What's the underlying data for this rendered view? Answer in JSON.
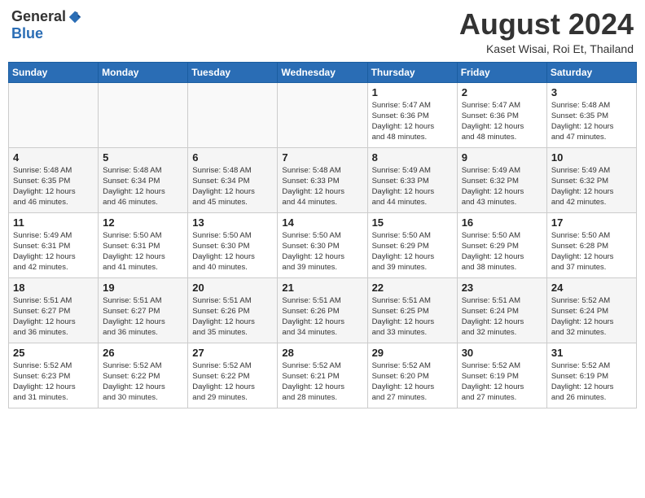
{
  "header": {
    "logo_general": "General",
    "logo_blue": "Blue",
    "month_year": "August 2024",
    "location": "Kaset Wisai, Roi Et, Thailand"
  },
  "weekdays": [
    "Sunday",
    "Monday",
    "Tuesday",
    "Wednesday",
    "Thursday",
    "Friday",
    "Saturday"
  ],
  "weeks": [
    [
      {
        "day": "",
        "empty": true
      },
      {
        "day": "",
        "empty": true
      },
      {
        "day": "",
        "empty": true
      },
      {
        "day": "",
        "empty": true
      },
      {
        "day": "1",
        "sunrise": "5:47 AM",
        "sunset": "6:36 PM",
        "daylight": "12 hours and 48 minutes."
      },
      {
        "day": "2",
        "sunrise": "5:47 AM",
        "sunset": "6:36 PM",
        "daylight": "12 hours and 48 minutes."
      },
      {
        "day": "3",
        "sunrise": "5:48 AM",
        "sunset": "6:35 PM",
        "daylight": "12 hours and 47 minutes."
      }
    ],
    [
      {
        "day": "4",
        "sunrise": "5:48 AM",
        "sunset": "6:35 PM",
        "daylight": "12 hours and 46 minutes."
      },
      {
        "day": "5",
        "sunrise": "5:48 AM",
        "sunset": "6:34 PM",
        "daylight": "12 hours and 46 minutes."
      },
      {
        "day": "6",
        "sunrise": "5:48 AM",
        "sunset": "6:34 PM",
        "daylight": "12 hours and 45 minutes."
      },
      {
        "day": "7",
        "sunrise": "5:48 AM",
        "sunset": "6:33 PM",
        "daylight": "12 hours and 44 minutes."
      },
      {
        "day": "8",
        "sunrise": "5:49 AM",
        "sunset": "6:33 PM",
        "daylight": "12 hours and 44 minutes."
      },
      {
        "day": "9",
        "sunrise": "5:49 AM",
        "sunset": "6:32 PM",
        "daylight": "12 hours and 43 minutes."
      },
      {
        "day": "10",
        "sunrise": "5:49 AM",
        "sunset": "6:32 PM",
        "daylight": "12 hours and 42 minutes."
      }
    ],
    [
      {
        "day": "11",
        "sunrise": "5:49 AM",
        "sunset": "6:31 PM",
        "daylight": "12 hours and 42 minutes."
      },
      {
        "day": "12",
        "sunrise": "5:50 AM",
        "sunset": "6:31 PM",
        "daylight": "12 hours and 41 minutes."
      },
      {
        "day": "13",
        "sunrise": "5:50 AM",
        "sunset": "6:30 PM",
        "daylight": "12 hours and 40 minutes."
      },
      {
        "day": "14",
        "sunrise": "5:50 AM",
        "sunset": "6:30 PM",
        "daylight": "12 hours and 39 minutes."
      },
      {
        "day": "15",
        "sunrise": "5:50 AM",
        "sunset": "6:29 PM",
        "daylight": "12 hours and 39 minutes."
      },
      {
        "day": "16",
        "sunrise": "5:50 AM",
        "sunset": "6:29 PM",
        "daylight": "12 hours and 38 minutes."
      },
      {
        "day": "17",
        "sunrise": "5:50 AM",
        "sunset": "6:28 PM",
        "daylight": "12 hours and 37 minutes."
      }
    ],
    [
      {
        "day": "18",
        "sunrise": "5:51 AM",
        "sunset": "6:27 PM",
        "daylight": "12 hours and 36 minutes."
      },
      {
        "day": "19",
        "sunrise": "5:51 AM",
        "sunset": "6:27 PM",
        "daylight": "12 hours and 36 minutes."
      },
      {
        "day": "20",
        "sunrise": "5:51 AM",
        "sunset": "6:26 PM",
        "daylight": "12 hours and 35 minutes."
      },
      {
        "day": "21",
        "sunrise": "5:51 AM",
        "sunset": "6:26 PM",
        "daylight": "12 hours and 34 minutes."
      },
      {
        "day": "22",
        "sunrise": "5:51 AM",
        "sunset": "6:25 PM",
        "daylight": "12 hours and 33 minutes."
      },
      {
        "day": "23",
        "sunrise": "5:51 AM",
        "sunset": "6:24 PM",
        "daylight": "12 hours and 32 minutes."
      },
      {
        "day": "24",
        "sunrise": "5:52 AM",
        "sunset": "6:24 PM",
        "daylight": "12 hours and 32 minutes."
      }
    ],
    [
      {
        "day": "25",
        "sunrise": "5:52 AM",
        "sunset": "6:23 PM",
        "daylight": "12 hours and 31 minutes."
      },
      {
        "day": "26",
        "sunrise": "5:52 AM",
        "sunset": "6:22 PM",
        "daylight": "12 hours and 30 minutes."
      },
      {
        "day": "27",
        "sunrise": "5:52 AM",
        "sunset": "6:22 PM",
        "daylight": "12 hours and 29 minutes."
      },
      {
        "day": "28",
        "sunrise": "5:52 AM",
        "sunset": "6:21 PM",
        "daylight": "12 hours and 28 minutes."
      },
      {
        "day": "29",
        "sunrise": "5:52 AM",
        "sunset": "6:20 PM",
        "daylight": "12 hours and 27 minutes."
      },
      {
        "day": "30",
        "sunrise": "5:52 AM",
        "sunset": "6:19 PM",
        "daylight": "12 hours and 27 minutes."
      },
      {
        "day": "31",
        "sunrise": "5:52 AM",
        "sunset": "6:19 PM",
        "daylight": "12 hours and 26 minutes."
      }
    ]
  ]
}
